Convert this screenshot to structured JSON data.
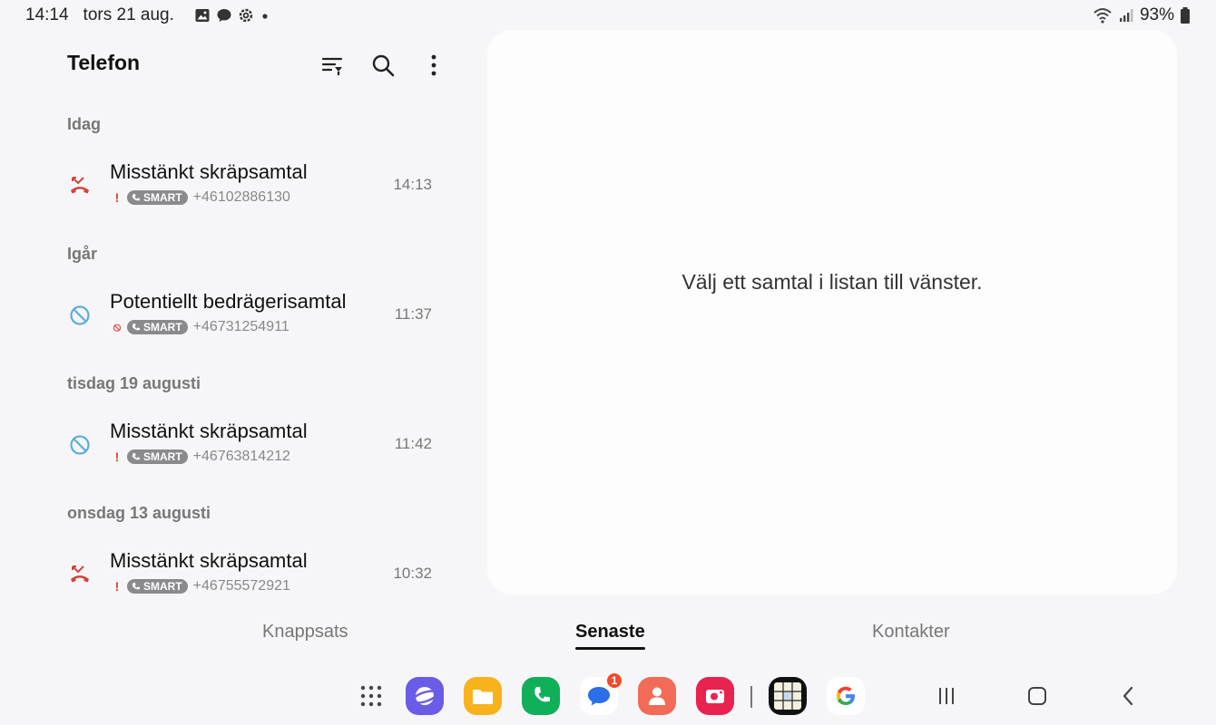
{
  "status": {
    "time": "14:14",
    "date": "tors 21 aug.",
    "battery": "93%"
  },
  "app": {
    "title": "Telefon"
  },
  "sections": [
    {
      "label": "Idag"
    },
    {
      "label": "Igår"
    },
    {
      "label": "tisdag 19 augusti"
    },
    {
      "label": "onsdag 13 augusti"
    }
  ],
  "calls": [
    {
      "title": "Misstänkt skräpsamtal",
      "badge": "SMART",
      "number": "+46102886130",
      "time": "14:13",
      "icon": "missed-call-icon",
      "mark": "!"
    },
    {
      "title": "Potentiellt bedrägerisamtal",
      "badge": "SMART",
      "number": "+46731254911",
      "time": "11:37",
      "icon": "blocked-call-icon",
      "mark": "⦸"
    },
    {
      "title": "Misstänkt skräpsamtal",
      "badge": "SMART",
      "number": "+46763814212",
      "time": "11:42",
      "icon": "blocked-call-icon",
      "mark": "!"
    },
    {
      "title": "Misstänkt skräpsamtal",
      "badge": "SMART",
      "number": "+46755572921",
      "time": "10:32",
      "icon": "missed-call-icon",
      "mark": "!"
    }
  ],
  "detail": {
    "placeholder": "Välj ett samtal i listan till vänster."
  },
  "tabs": [
    {
      "label": "Knappsats"
    },
    {
      "label": "Senaste"
    },
    {
      "label": "Kontakter"
    }
  ],
  "dock": {
    "messages_badge": "1"
  },
  "colors": {
    "missed": "#d0453a",
    "blocked": "#5aaed8",
    "background": "#f6f6f8",
    "card": "#fdfdfd"
  }
}
